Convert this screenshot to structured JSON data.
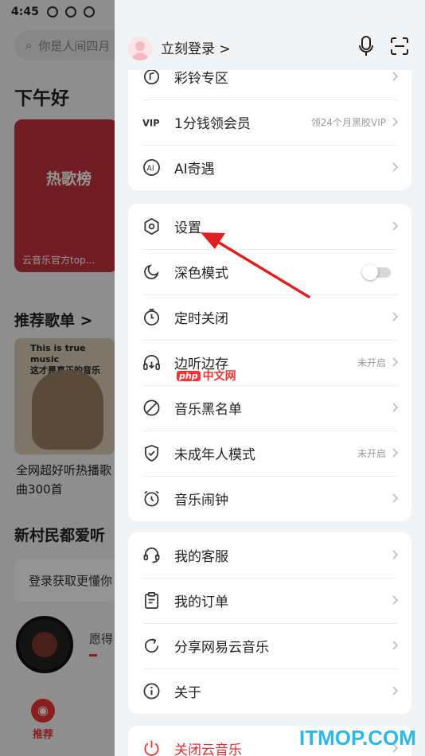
{
  "status_bar": {
    "time": "4:45"
  },
  "background": {
    "search_placeholder": "你是人间四月",
    "greeting": "下午好",
    "banner_title": "热歌榜",
    "banner_caption": "云音乐官方top...",
    "section_recommend": "推荐歌单 >",
    "cover_caption_1": "This is true music",
    "cover_caption_2": "这才是真正的音乐",
    "playlist_title_line1": "全网超好听热播歌",
    "playlist_title_line2": "曲300首",
    "section_new": "新村民都爱听",
    "login_prompt": "登录获取更懂你",
    "song_title": "愿得",
    "tab_recommend": "推荐"
  },
  "drawer": {
    "header": {
      "login_label": "立刻登录 >"
    },
    "group1": [
      {
        "icon": "ringtone-icon",
        "label": "彩铃专区",
        "hint": ""
      },
      {
        "icon": "vip-icon",
        "label": "1分钱领会员",
        "hint": "领24个月黑胶VIP"
      },
      {
        "icon": "ai-icon",
        "label": "AI奇遇",
        "hint": ""
      }
    ],
    "group2": [
      {
        "icon": "settings-icon",
        "label": "设置",
        "hint": ""
      },
      {
        "icon": "dark-mode-icon",
        "label": "深色模式",
        "hint": "",
        "toggle": false
      },
      {
        "icon": "timer-icon",
        "label": "定时关闭",
        "hint": ""
      },
      {
        "icon": "headphone-cache-icon",
        "label": "边听边存",
        "hint": "未开启"
      },
      {
        "icon": "blocklist-icon",
        "label": "音乐黑名单",
        "hint": ""
      },
      {
        "icon": "shield-icon",
        "label": "未成年人模式",
        "hint": "未开启"
      },
      {
        "icon": "alarm-icon",
        "label": "音乐闹钟",
        "hint": ""
      }
    ],
    "group3": [
      {
        "icon": "headset-icon",
        "label": "我的客服",
        "hint": ""
      },
      {
        "icon": "order-icon",
        "label": "我的订单",
        "hint": ""
      },
      {
        "icon": "share-icon",
        "label": "分享网易云音乐",
        "hint": ""
      },
      {
        "icon": "info-icon",
        "label": "关于",
        "hint": ""
      }
    ],
    "group4": [
      {
        "icon": "power-icon",
        "label": "关闭云音乐",
        "hint": ""
      }
    ]
  },
  "watermarks": {
    "php_badge": "php",
    "php_text": "中文网",
    "itmop": "ITMOP.COM"
  },
  "colors": {
    "brand_red": "#e03030",
    "watermark_blue": "#2db8e9",
    "annotation_arrow": "#e02020"
  }
}
